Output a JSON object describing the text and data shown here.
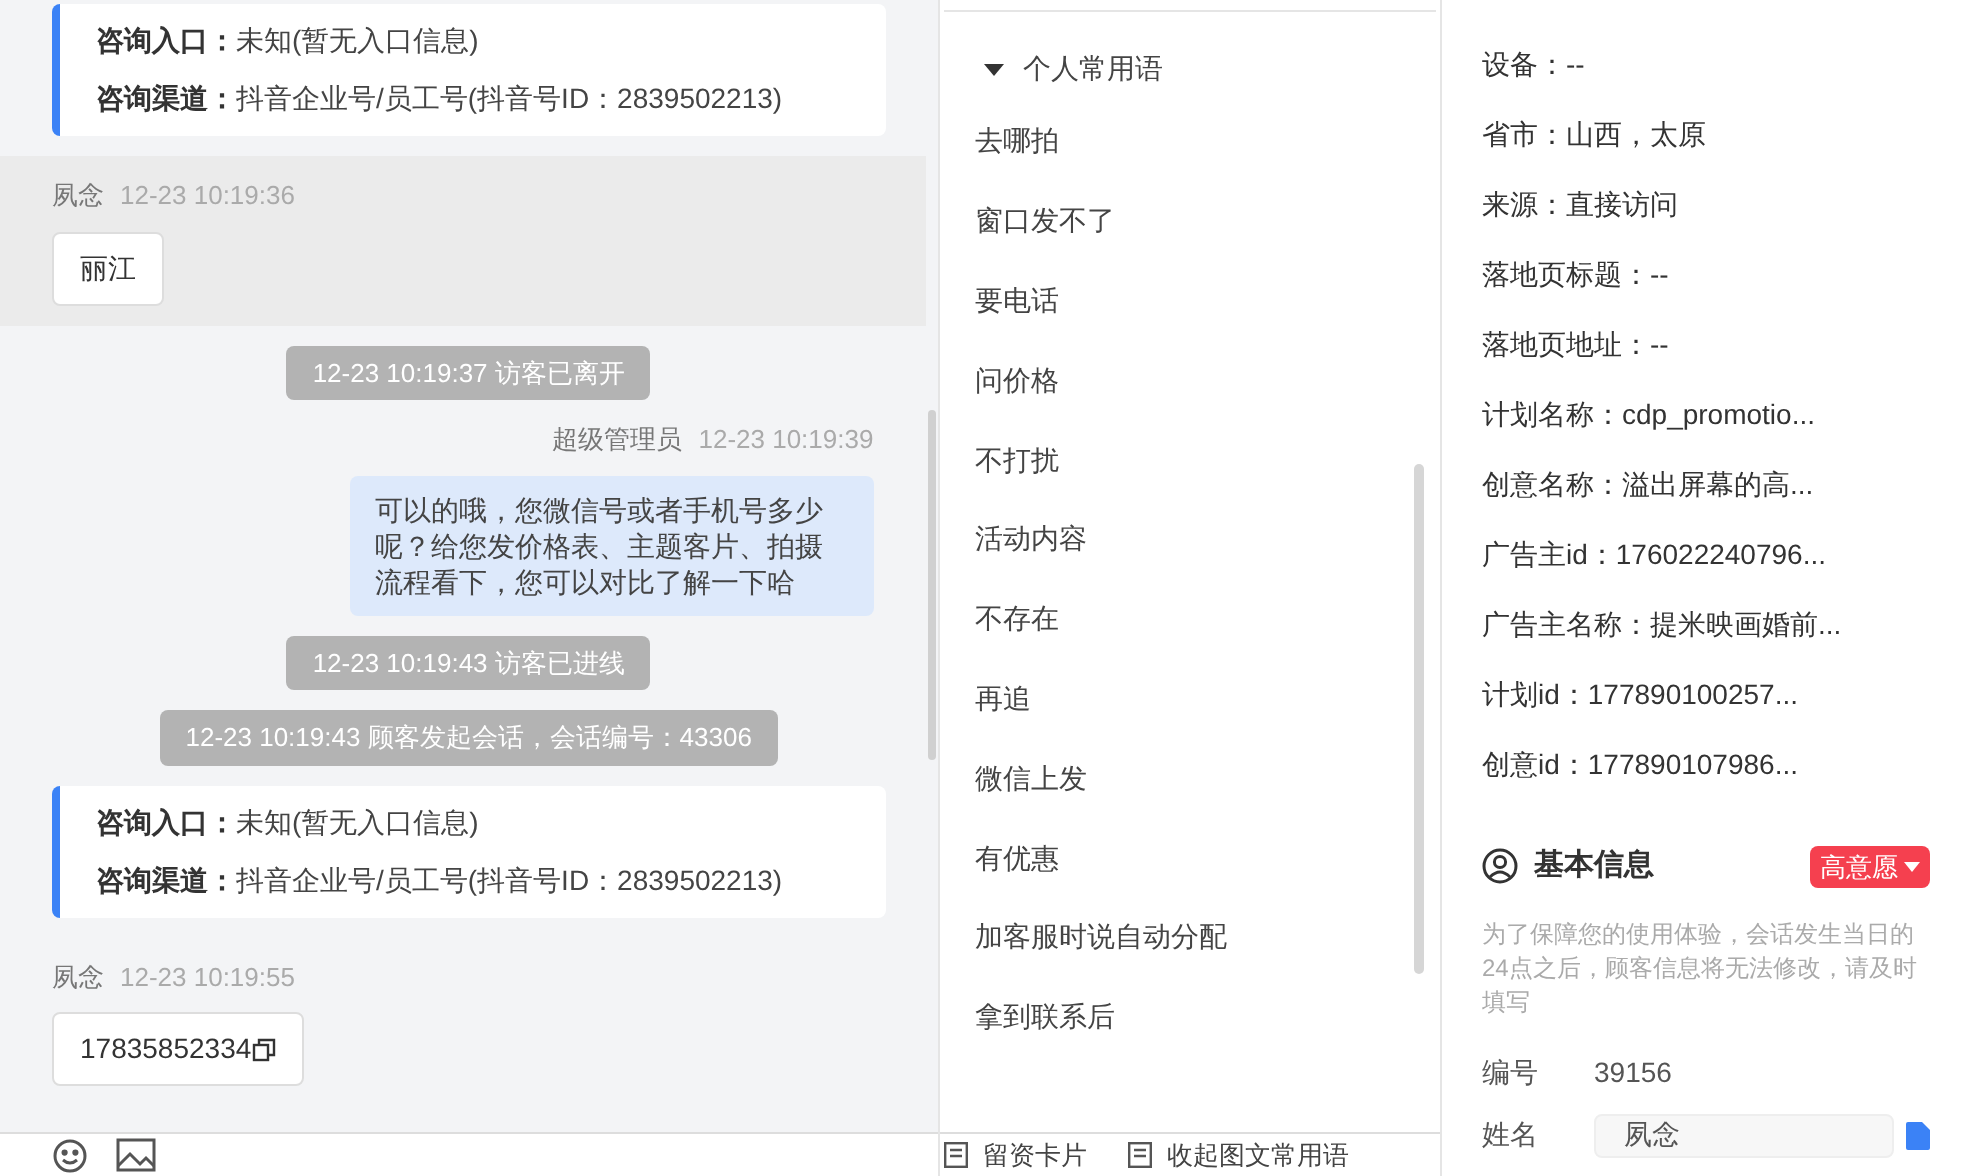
{
  "chat": {
    "messages": [
      {
        "kind": "info",
        "rows": [
          {
            "label": "咨询入口：",
            "value": "未知(暂无入口信息)"
          },
          {
            "label": "咨询渠道：",
            "value": "抖音企业号/员工号(抖音号ID：2839502213)"
          }
        ]
      },
      {
        "kind": "visitor",
        "highlighted": true,
        "name": "夙念",
        "time": "12-23 10:19:36",
        "text": "丽江",
        "copyable": false
      },
      {
        "kind": "system",
        "text": "12-23 10:19:37 访客已离开"
      },
      {
        "kind": "agent",
        "name": "超级管理员",
        "time": "12-23 10:19:39",
        "text": "可以的哦，您微信号或者手机号多少呢？给您发价格表、主题客片、拍摄流程看下，您可以对比了解一下哈"
      },
      {
        "kind": "system",
        "text": "12-23 10:19:43 访客已进线"
      },
      {
        "kind": "system",
        "text": "12-23 10:19:43 顾客发起会话，会话编号：43306"
      },
      {
        "kind": "info",
        "rows": [
          {
            "label": "咨询入口：",
            "value": "未知(暂无入口信息)"
          },
          {
            "label": "咨询渠道：",
            "value": "抖音企业号/员工号(抖音号ID：2839502213)"
          }
        ]
      },
      {
        "kind": "visitor",
        "highlighted": false,
        "name": "夙念",
        "time": "12-23 10:19:55",
        "text": "17835852334",
        "copyable": true
      }
    ]
  },
  "phrases": {
    "group": {
      "title": "个人常用语",
      "expanded": true
    },
    "items": [
      "去哪拍",
      "窗口发不了",
      "要电话",
      "问价格",
      "不打扰",
      "活动内容",
      "不存在",
      "再追",
      "微信上发",
      "有优惠",
      "加客服时说自动分配",
      "拿到联系后"
    ],
    "buttons": [
      "留资卡片",
      "收起图文常用语"
    ]
  },
  "visitor_info": {
    "fields": [
      "设备：--",
      "省市：山西，太原",
      "来源：直接访问",
      "落地页标题：--",
      "落地页地址：--",
      "计划名称：cdp_promotio...",
      "创意名称：溢出屏幕的高...",
      "广告主id：176022240796...",
      "广告主名称：提米映画婚前...",
      "计划id：177890100257...",
      "创意id：177890107986..."
    ]
  },
  "basic_info": {
    "title": "基本信息",
    "intent": {
      "label": "高意愿",
      "color": "#f5404f"
    },
    "note": "为了保障您的使用体验，会话发生当日的24点之后，顾客信息将无法修改，请及时填写",
    "fields": [
      {
        "label": "编号",
        "value": "39156",
        "kind": "text"
      },
      {
        "label": "姓名",
        "value": "夙念",
        "kind": "input"
      }
    ]
  }
}
